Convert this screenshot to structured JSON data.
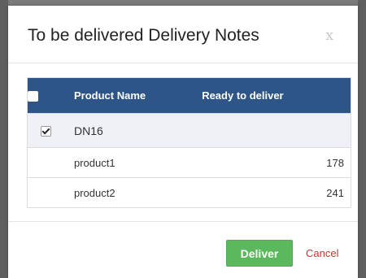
{
  "modal": {
    "title": "To be delivered Delivery Notes",
    "close_label": "x"
  },
  "table": {
    "headers": {
      "product_name": "Product Name",
      "ready_to_deliver": "Ready to deliver"
    },
    "header_checkbox_checked": false,
    "delivery_note": {
      "name": "DN16",
      "checked": true
    },
    "rows": [
      {
        "product": "product1",
        "ready": "178"
      },
      {
        "product": "product2",
        "ready": "241"
      }
    ]
  },
  "footer": {
    "deliver_label": "Deliver",
    "cancel_label": "Cancel"
  },
  "colors": {
    "header_bg": "#2d5587",
    "deliver_green": "#5cb85c",
    "cancel_red": "#c0392b"
  }
}
